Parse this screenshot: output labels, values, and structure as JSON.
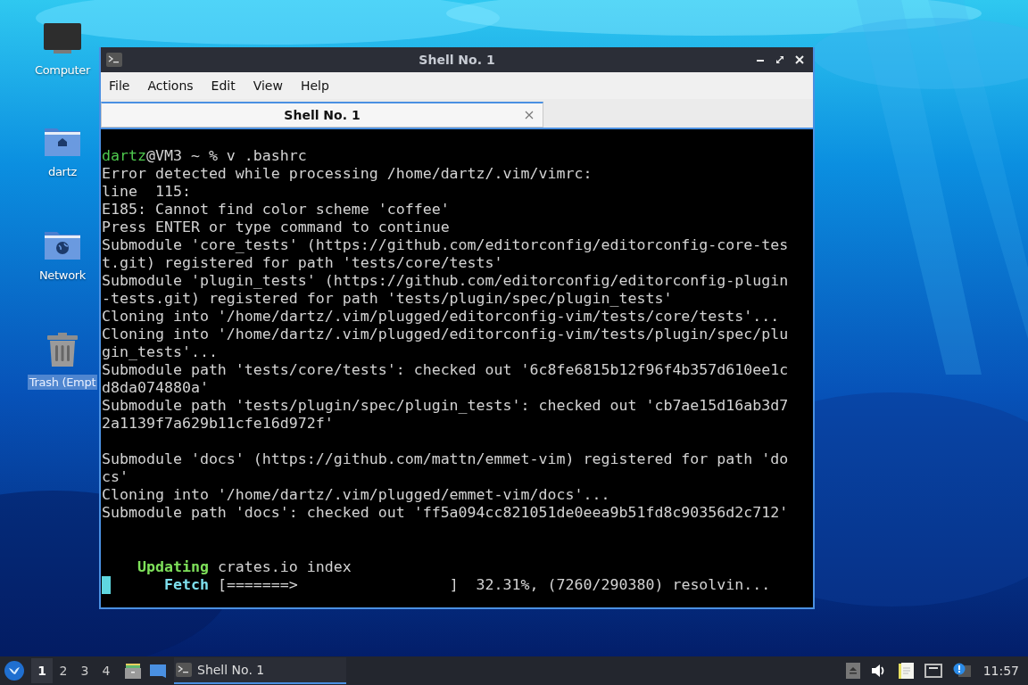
{
  "desktop_icons": [
    {
      "kind": "computer",
      "label": "Computer",
      "selected": false
    },
    {
      "kind": "home",
      "label": "dartz",
      "selected": false
    },
    {
      "kind": "network",
      "label": "Network",
      "selected": false
    },
    {
      "kind": "trash",
      "label": "Trash (Empt",
      "selected": true
    }
  ],
  "window": {
    "title": "Shell No. 1",
    "menu": [
      "File",
      "Actions",
      "Edit",
      "View",
      "Help"
    ],
    "tabs": [
      {
        "label": "Shell No. 1",
        "selected": true
      }
    ],
    "terminal": {
      "blocks": [
        [
          {
            "segments": [
              {
                "kind": "user",
                "text": "dartz"
              },
              {
                "kind": "plain",
                "text": "@VM3 ~ % v .bashrc"
              }
            ]
          },
          {
            "segments": [
              {
                "kind": "plain",
                "text": "Error detected while processing /home/dartz/.vim/vimrc:"
              }
            ]
          },
          {
            "segments": [
              {
                "kind": "plain",
                "text": "line  115:"
              }
            ]
          },
          {
            "segments": [
              {
                "kind": "plain",
                "text": "E185: Cannot find color scheme 'coffee'"
              }
            ]
          },
          {
            "segments": [
              {
                "kind": "plain",
                "text": "Press ENTER or type command to continue"
              }
            ]
          },
          {
            "segments": [
              {
                "kind": "plain",
                "text": "Submodule 'core_tests' (https://github.com/editorconfig/editorconfig-core-tes"
              }
            ]
          },
          {
            "segments": [
              {
                "kind": "plain",
                "text": "t.git) registered for path 'tests/core/tests'"
              }
            ]
          },
          {
            "segments": [
              {
                "kind": "plain",
                "text": "Submodule 'plugin_tests' (https://github.com/editorconfig/editorconfig-plugin"
              }
            ]
          },
          {
            "segments": [
              {
                "kind": "plain",
                "text": "-tests.git) registered for path 'tests/plugin/spec/plugin_tests'"
              }
            ]
          },
          {
            "segments": [
              {
                "kind": "plain",
                "text": "Cloning into '/home/dartz/.vim/plugged/editorconfig-vim/tests/core/tests'..."
              }
            ]
          },
          {
            "segments": [
              {
                "kind": "plain",
                "text": "Cloning into '/home/dartz/.vim/plugged/editorconfig-vim/tests/plugin/spec/plu"
              }
            ]
          },
          {
            "segments": [
              {
                "kind": "plain",
                "text": "gin_tests'..."
              }
            ]
          },
          {
            "segments": [
              {
                "kind": "plain",
                "text": "Submodule path 'tests/core/tests': checked out '6c8fe6815b12f96f4b357d610ee1c"
              }
            ]
          },
          {
            "segments": [
              {
                "kind": "plain",
                "text": "d8da074880a'"
              }
            ]
          },
          {
            "segments": [
              {
                "kind": "plain",
                "text": "Submodule path 'tests/plugin/spec/plugin_tests': checked out 'cb7ae15d16ab3d7"
              }
            ]
          },
          {
            "segments": [
              {
                "kind": "plain",
                "text": "2a1139f7a629b11cfe16d972f'"
              }
            ]
          }
        ],
        [
          {
            "segments": [
              {
                "kind": "plain",
                "text": "Submodule 'docs' (https://github.com/mattn/emmet-vim) registered for path 'do"
              }
            ]
          },
          {
            "segments": [
              {
                "kind": "plain",
                "text": "cs'"
              }
            ]
          },
          {
            "segments": [
              {
                "kind": "plain",
                "text": "Cloning into '/home/dartz/.vim/plugged/emmet-vim/docs'..."
              }
            ]
          },
          {
            "segments": [
              {
                "kind": "plain",
                "text": "Submodule path 'docs': checked out 'ff5a094cc821051de0eea9b51fd8c90356d2c712'"
              }
            ]
          }
        ]
      ],
      "status": [
        {
          "cursor": false,
          "segments": [
            {
              "kind": "green-bold",
              "text": "    Updating"
            },
            {
              "kind": "plain",
              "text": " crates.io index"
            }
          ]
        },
        {
          "cursor": true,
          "segments": [
            {
              "kind": "cyan-bold",
              "text": "      Fetch"
            },
            {
              "kind": "plain",
              "text": " [=======>                 ]  32.31%, (7260/290380) resolvin..."
            }
          ]
        }
      ]
    }
  },
  "taskbar": {
    "workspaces": [
      {
        "label": "1",
        "selected": true
      },
      {
        "label": "2",
        "selected": false
      },
      {
        "label": "3",
        "selected": false
      },
      {
        "label": "4",
        "selected": false
      }
    ],
    "tasks": [
      {
        "label": "Shell No. 1",
        "selected": true
      }
    ],
    "clock": "11:57"
  }
}
